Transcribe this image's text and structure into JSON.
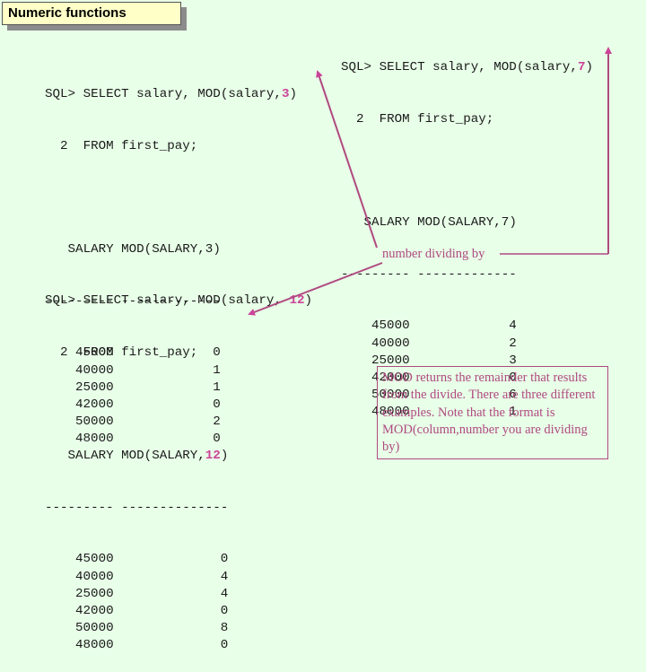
{
  "title": "Numeric functions",
  "queries": [
    {
      "id": "mod3",
      "line1_prefix": "SQL> SELECT salary, MOD(salary,",
      "divisor": "3",
      "line1_suffix": ")",
      "line2": "  2  FROM first_pay;",
      "header_prefix": "   SALARY MOD(SALARY,",
      "header_divisor": "3",
      "header_suffix": ")",
      "header_highlight": false,
      "separator": "--------- -------------",
      "rows": [
        {
          "salary": "45000",
          "mod": "0"
        },
        {
          "salary": "40000",
          "mod": "1"
        },
        {
          "salary": "25000",
          "mod": "1"
        },
        {
          "salary": "42000",
          "mod": "0"
        },
        {
          "salary": "50000",
          "mod": "2"
        },
        {
          "salary": "48000",
          "mod": "0"
        }
      ]
    },
    {
      "id": "mod7",
      "line1_prefix": "SQL> SELECT salary, MOD(salary,",
      "divisor": "7",
      "line1_suffix": ")",
      "line2": "  2  FROM first_pay;",
      "header_prefix": "   SALARY MOD(SALARY,",
      "header_divisor": "7",
      "header_suffix": ")",
      "header_highlight": false,
      "separator": "--------- -------------",
      "rows": [
        {
          "salary": "45000",
          "mod": "4"
        },
        {
          "salary": "40000",
          "mod": "2"
        },
        {
          "salary": "25000",
          "mod": "3"
        },
        {
          "salary": "42000",
          "mod": "0"
        },
        {
          "salary": "50000",
          "mod": "6"
        },
        {
          "salary": "48000",
          "mod": "1"
        }
      ]
    },
    {
      "id": "mod12",
      "line1_prefix": "SQL> SELECT salary, MOD(salary, ",
      "divisor": "12",
      "line1_suffix": ")",
      "line2": "  2  FROM first_pay;",
      "header_prefix": "   SALARY MOD(SALARY,",
      "header_divisor": "12",
      "header_suffix": ")",
      "header_highlight": true,
      "separator": "--------- --------------",
      "rows": [
        {
          "salary": "45000",
          "mod": "0"
        },
        {
          "salary": "40000",
          "mod": "4"
        },
        {
          "salary": "25000",
          "mod": "4"
        },
        {
          "salary": "42000",
          "mod": "0"
        },
        {
          "salary": "50000",
          "mod": "8"
        },
        {
          "salary": "48000",
          "mod": "0"
        }
      ]
    }
  ],
  "annotation_label": "number dividing by",
  "note": "MOD returns the remainder that results from the divide.  There are three different examples.  Note that the format is MOD(column,number you are dividing by)",
  "colors": {
    "background": "#e8ffe8",
    "highlight": "#cc4499",
    "annotation": "#b04a80",
    "title_bg": "#ffffc8"
  }
}
